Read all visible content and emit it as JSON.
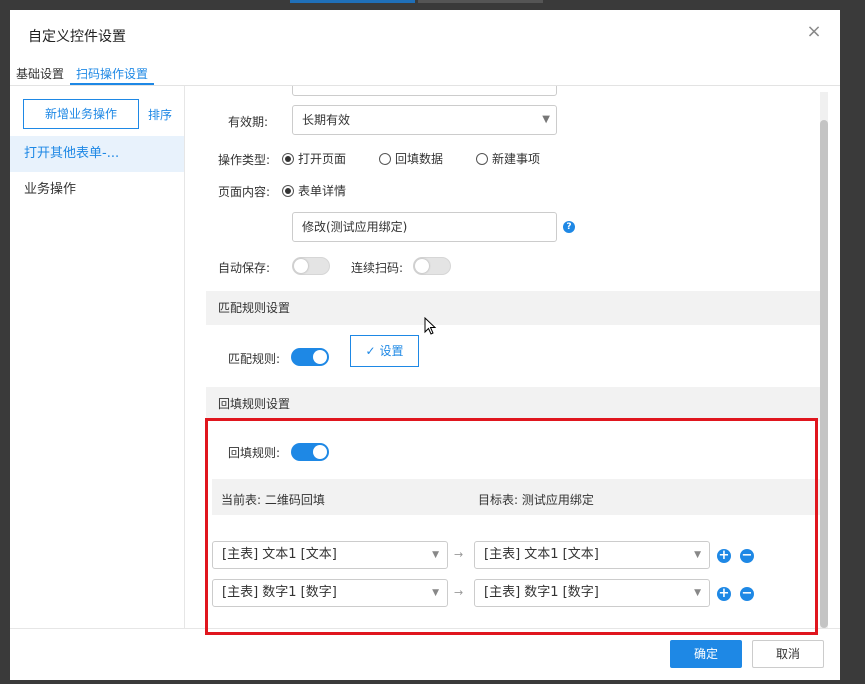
{
  "dialog": {
    "title": "自定义控件设置",
    "close_icon": "close-icon"
  },
  "tabs": [
    {
      "label": "基础设置",
      "active": false
    },
    {
      "label": "扫码操作设置",
      "active": true
    }
  ],
  "sidebar": {
    "add_button": "新增业务操作",
    "sort_link": "排序",
    "items": [
      {
        "label": "打开其他表单-...",
        "active": true
      },
      {
        "label": "业务操作",
        "active": false
      }
    ]
  },
  "form": {
    "validity_label": "有效期:",
    "validity_value": "长期有效",
    "op_type_label": "操作类型:",
    "op_type_options": [
      {
        "label": "打开页面",
        "selected": true
      },
      {
        "label": "回填数据",
        "selected": false
      },
      {
        "label": "新建事项",
        "selected": false
      }
    ],
    "page_content_label": "页面内容:",
    "page_content_option": "表单详情",
    "form_select_value": "修改(测试应用绑定)",
    "help_icon": "?",
    "auto_save_label": "自动保存:",
    "auto_save_on": false,
    "continuous_scan_label": "连续扫码:",
    "continuous_scan_on": false
  },
  "match_section": {
    "title": "匹配规则设置",
    "rule_label": "匹配规则:",
    "rule_on": true,
    "settings_button": "设置"
  },
  "backfill_section": {
    "title": "回填规则设置",
    "rule_label": "回填规则:",
    "rule_on": true,
    "current_table_label": "当前表: 二维码回填",
    "target_table_label": "目标表: 测试应用绑定",
    "mappings": [
      {
        "source": "[主表] 文本1 [文本]",
        "target": "[主表] 文本1 [文本]"
      },
      {
        "source": "[主表] 数字1 [数字]",
        "target": "[主表] 数字1 [数字]"
      }
    ],
    "plus_glyph": "+",
    "minus_glyph": "−",
    "arrow_glyph": "→"
  },
  "footer": {
    "ok": "确定",
    "cancel": "取消"
  },
  "colors": {
    "accent": "#1e88e5",
    "highlight_border": "#e0161e"
  }
}
